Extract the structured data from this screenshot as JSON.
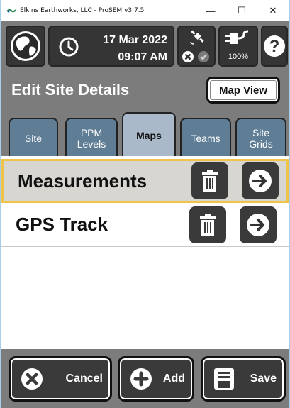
{
  "window": {
    "title": "Elkins Earthworks, LLC - ProSEM v3.7.5",
    "controls": {
      "minimize": "—",
      "maximize": "☐",
      "close": "✕"
    }
  },
  "header": {
    "globe_icon": "globe-icon",
    "clock_icon": "clock-icon",
    "date": "17 Mar 2022",
    "time": "09:07 AM",
    "satellite_icon": "satellite-icon",
    "gps_status_icons": [
      "x-circle-icon",
      "check-circle-icon"
    ],
    "power_icon": "plug-icon",
    "battery": "100%",
    "help_icon": "question-icon"
  },
  "page": {
    "title": "Edit Site Details",
    "map_view_label": "Map View"
  },
  "tabs": [
    {
      "label": "Site",
      "active": false
    },
    {
      "label": "PPM Levels",
      "active": false
    },
    {
      "label": "Maps",
      "active": true
    },
    {
      "label": "Teams",
      "active": false
    },
    {
      "label": "Site Grids",
      "active": false
    }
  ],
  "maps_list": [
    {
      "label": "Measurements",
      "selected": true
    },
    {
      "label": "GPS Track",
      "selected": false
    }
  ],
  "footer": {
    "cancel_label": "Cancel",
    "add_label": "Add",
    "save_label": "Save"
  },
  "colors": {
    "toolbar_bg": "#7c7c7c",
    "button_dark": "#3a3a3a",
    "tab_inactive": "#5f7d95",
    "tab_active": "#a9b9c9",
    "selected_border": "#f0c34a",
    "selected_bg": "#d8d6d0"
  }
}
